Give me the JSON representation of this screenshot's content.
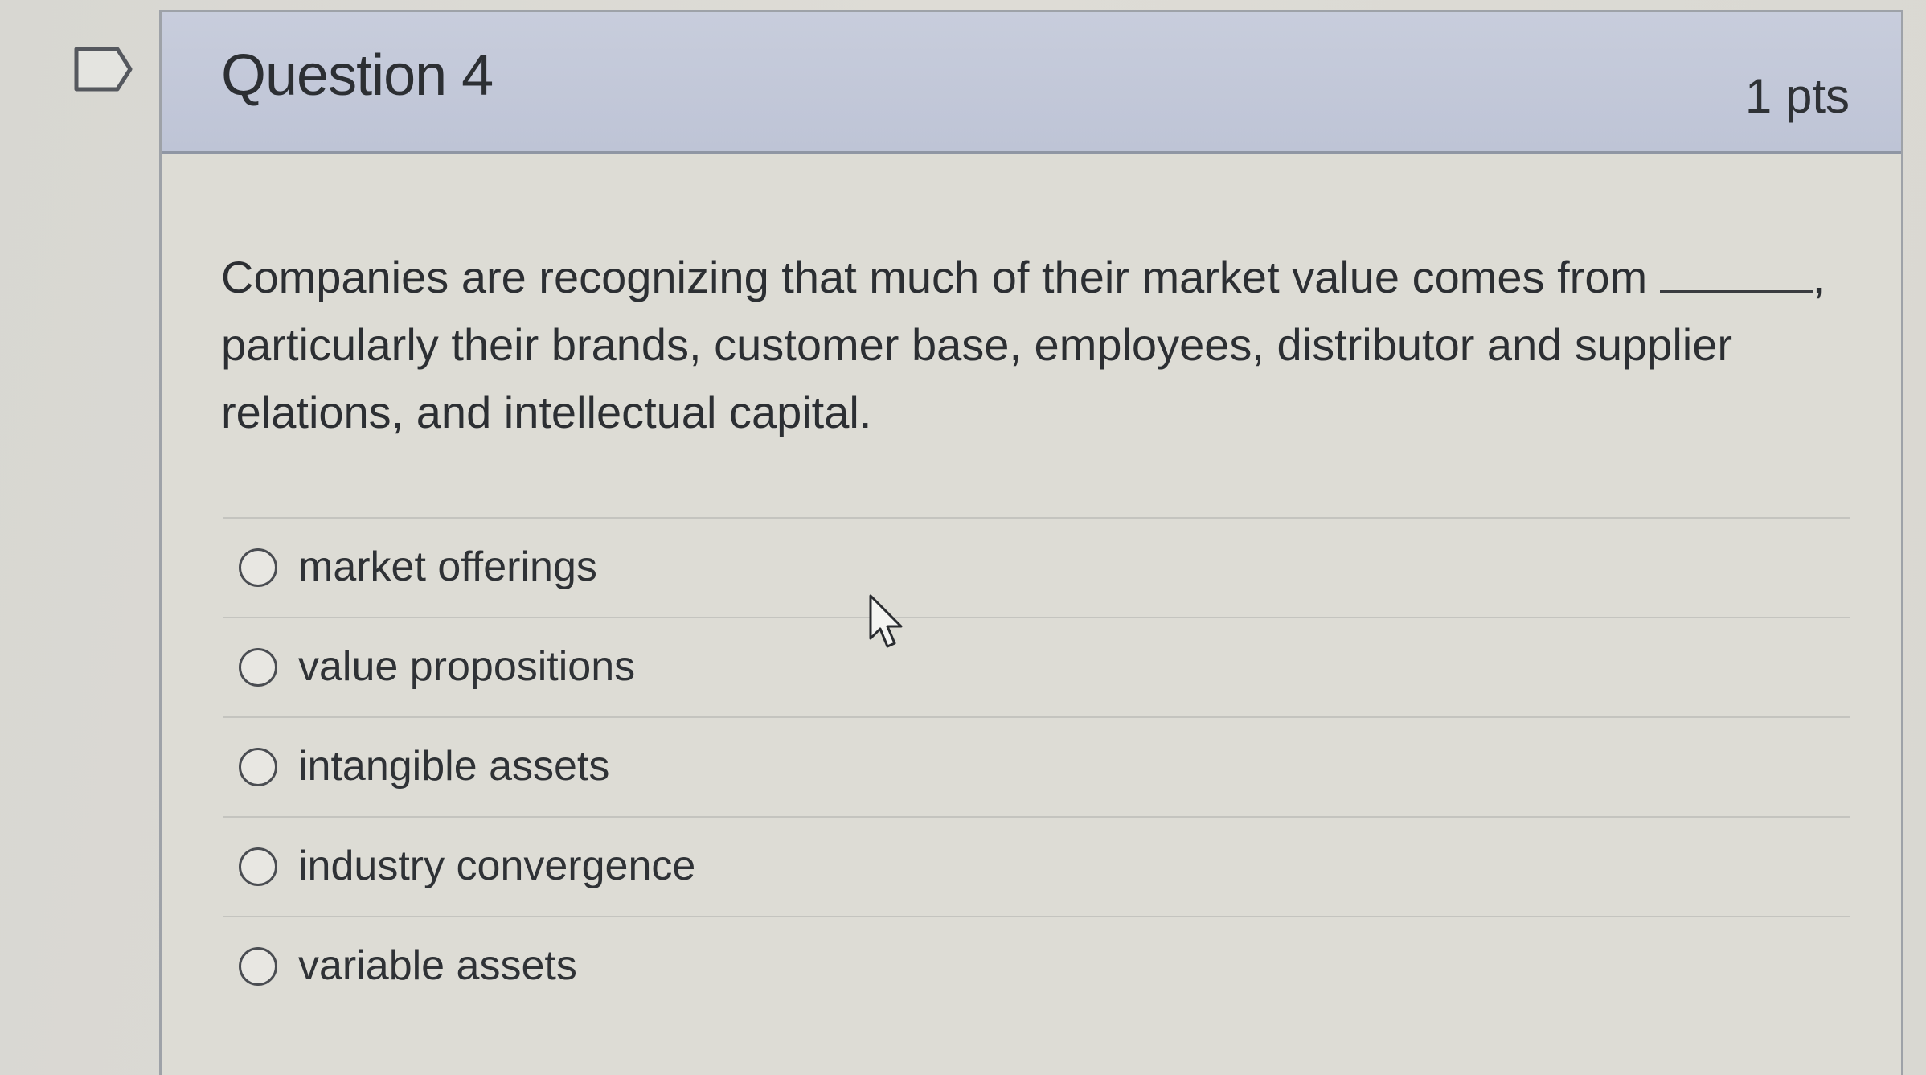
{
  "question": {
    "title": "Question 4",
    "points": "1 pts",
    "text_before": "Companies are recognizing that much of their market value comes from ",
    "text_after": ", particularly their brands, customer base, employees, distributor and supplier relations, and intellectual capital."
  },
  "answers": [
    {
      "label": "market offerings",
      "selected": false
    },
    {
      "label": "value propositions",
      "selected": false
    },
    {
      "label": "intangible assets",
      "selected": false
    },
    {
      "label": "industry convergence",
      "selected": false
    },
    {
      "label": "variable assets",
      "selected": false
    }
  ],
  "icons": {
    "flag": "flag-icon",
    "cursor": "mouse-pointer-icon"
  },
  "colors": {
    "header_bg": "#c6cbdb",
    "page_bg": "#dddcd5",
    "text": "#2c2f33"
  }
}
